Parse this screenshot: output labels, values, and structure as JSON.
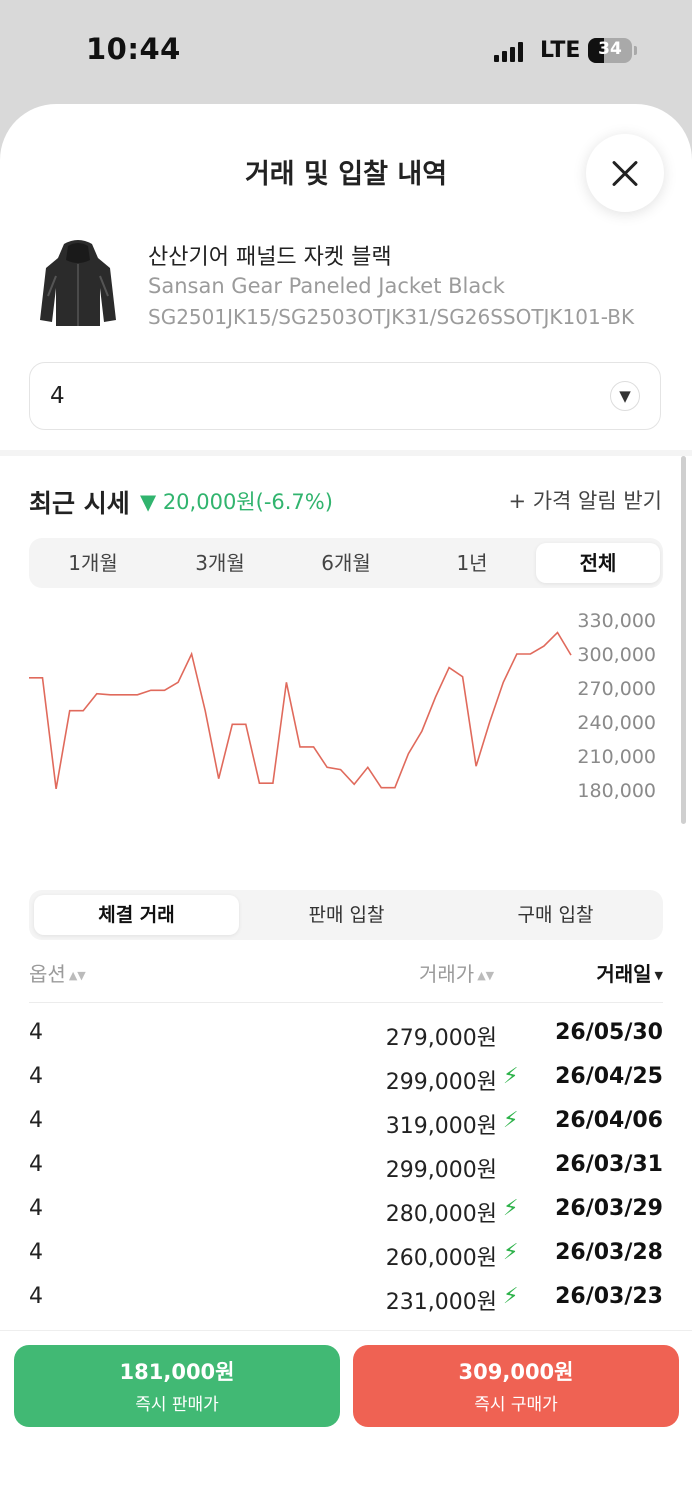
{
  "status_bar": {
    "time": "10:44",
    "network": "LTE",
    "battery": "34"
  },
  "sheet": {
    "title": "거래 및 입찰 내역"
  },
  "product": {
    "name_ko": "산산기어 패널드 자켓 블랙",
    "name_en": "Sansan Gear Paneled Jacket Black",
    "codes": "SG2501JK15/SG2503OTJK31/SG26SSOTJK101-BK",
    "image_icon": "black-hooded-jacket"
  },
  "option_select": {
    "value": "4"
  },
  "recent_price": {
    "label": "최근 시세",
    "change": "▼ 20,000원(-6.7%)",
    "alert_label": "+ 가격 알림 받기"
  },
  "period_tabs": [
    "1개월",
    "3개월",
    "6개월",
    "1년",
    "전체"
  ],
  "period_active": "전체",
  "chart_data": {
    "type": "line",
    "title": "",
    "ylabel": "",
    "yticks": [
      "330,000",
      "300,000",
      "270,000",
      "240,000",
      "210,000",
      "180,000"
    ],
    "ylim": [
      180000,
      330000
    ],
    "color": "#e06a5c",
    "series": [
      {
        "values": [
          279000,
          279000,
          181000,
          250000,
          250000,
          265000,
          264000,
          264000,
          264000,
          268000,
          268000,
          275000,
          300000,
          250000,
          190000,
          238000,
          238000,
          186000,
          186000,
          275000,
          218000,
          218000,
          200000,
          198000,
          185000,
          200000,
          182000,
          182000,
          212000,
          232000,
          262000,
          288000,
          280000,
          201000,
          240000,
          275000,
          300000,
          300000,
          307000,
          319000,
          299000
        ]
      }
    ]
  },
  "trade_tabs": [
    "체결 거래",
    "판매 입찰",
    "구매 입찰"
  ],
  "trade_tab_active": "체결 거래",
  "table": {
    "headers": {
      "option": "옵션",
      "price": "거래가",
      "date": "거래일"
    },
    "rows": [
      {
        "option": "4",
        "price": "279,000원",
        "fast": false,
        "date": "26/05/30"
      },
      {
        "option": "4",
        "price": "299,000원",
        "fast": true,
        "date": "26/04/25"
      },
      {
        "option": "4",
        "price": "319,000원",
        "fast": true,
        "date": "26/04/06"
      },
      {
        "option": "4",
        "price": "299,000원",
        "fast": false,
        "date": "26/03/31"
      },
      {
        "option": "4",
        "price": "280,000원",
        "fast": true,
        "date": "26/03/29"
      },
      {
        "option": "4",
        "price": "260,000원",
        "fast": true,
        "date": "26/03/28"
      },
      {
        "option": "4",
        "price": "231,000원",
        "fast": true,
        "date": "26/03/23"
      }
    ]
  },
  "actions": {
    "sell": {
      "price": "181,000원",
      "label": "즉시 판매가",
      "color": "#41b974"
    },
    "buy": {
      "price": "309,000원",
      "label": "즉시 구매가",
      "color": "#ef6253"
    }
  }
}
